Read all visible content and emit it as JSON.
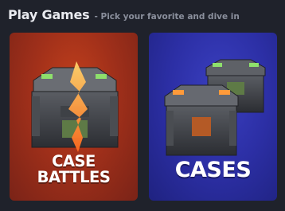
{
  "header": {
    "title": "Play Games",
    "subtitle": "- Pick your favorite and dive in"
  },
  "cards": [
    {
      "label_line1": "CASE",
      "label_line2": "BATTLES",
      "background": "#a1301a",
      "icon": "split-case-icon"
    },
    {
      "label": "CASES",
      "background": "#2c2fa5",
      "icon": "stacked-cases-icon"
    }
  ]
}
